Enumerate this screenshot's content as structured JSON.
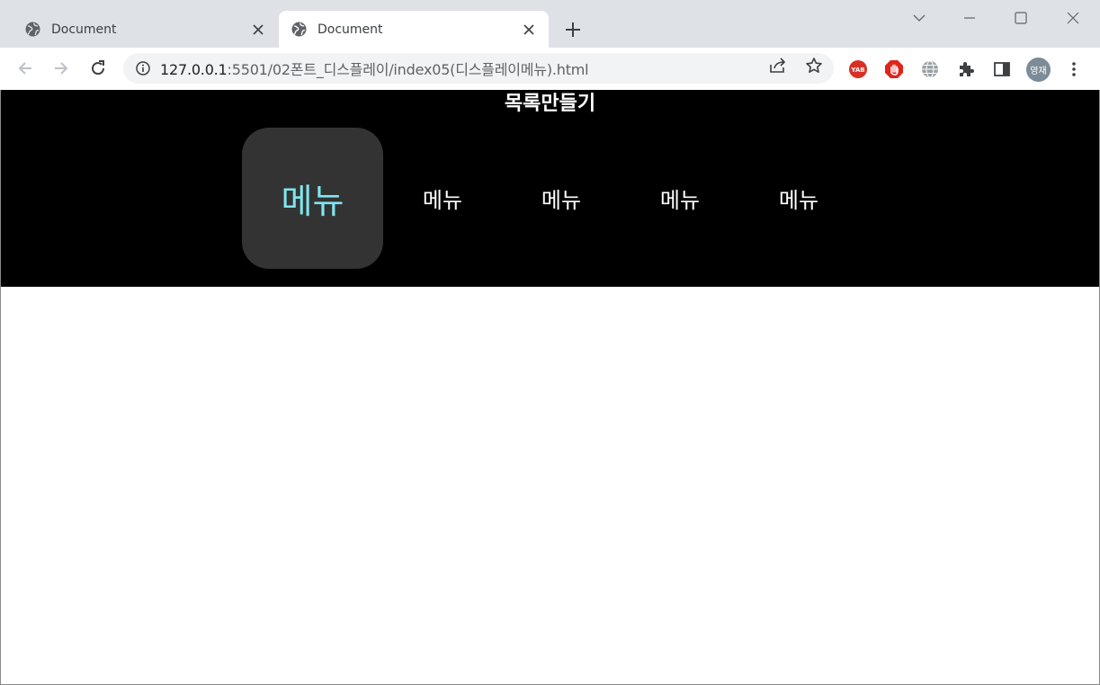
{
  "browser": {
    "tabs": [
      {
        "title": "Document",
        "active": false
      },
      {
        "title": "Document",
        "active": true
      }
    ],
    "address": {
      "host": "127.0.0.1",
      "rest": ":5501/02폰트_디스플레이/index05(디스플레이메뉴).html"
    },
    "profile_initials": "영재",
    "extensions": [
      "yab-icon",
      "adblock-icon",
      "globe-icon",
      "puzzle-icon",
      "sidepanel-icon"
    ],
    "colors": {
      "tabstrip": "#dee1e6",
      "omnibox": "#f1f3f4"
    }
  },
  "page": {
    "heading": "목록만들기",
    "menu": [
      {
        "label": "메뉴",
        "active": true
      },
      {
        "label": "메뉴",
        "active": false
      },
      {
        "label": "메뉴",
        "active": false
      },
      {
        "label": "메뉴",
        "active": false
      },
      {
        "label": "메뉴",
        "active": false
      }
    ],
    "colors": {
      "header_bg": "#000000",
      "active_bg": "#333333",
      "active_text": "#7fe6ef",
      "text": "#ffffff"
    }
  }
}
